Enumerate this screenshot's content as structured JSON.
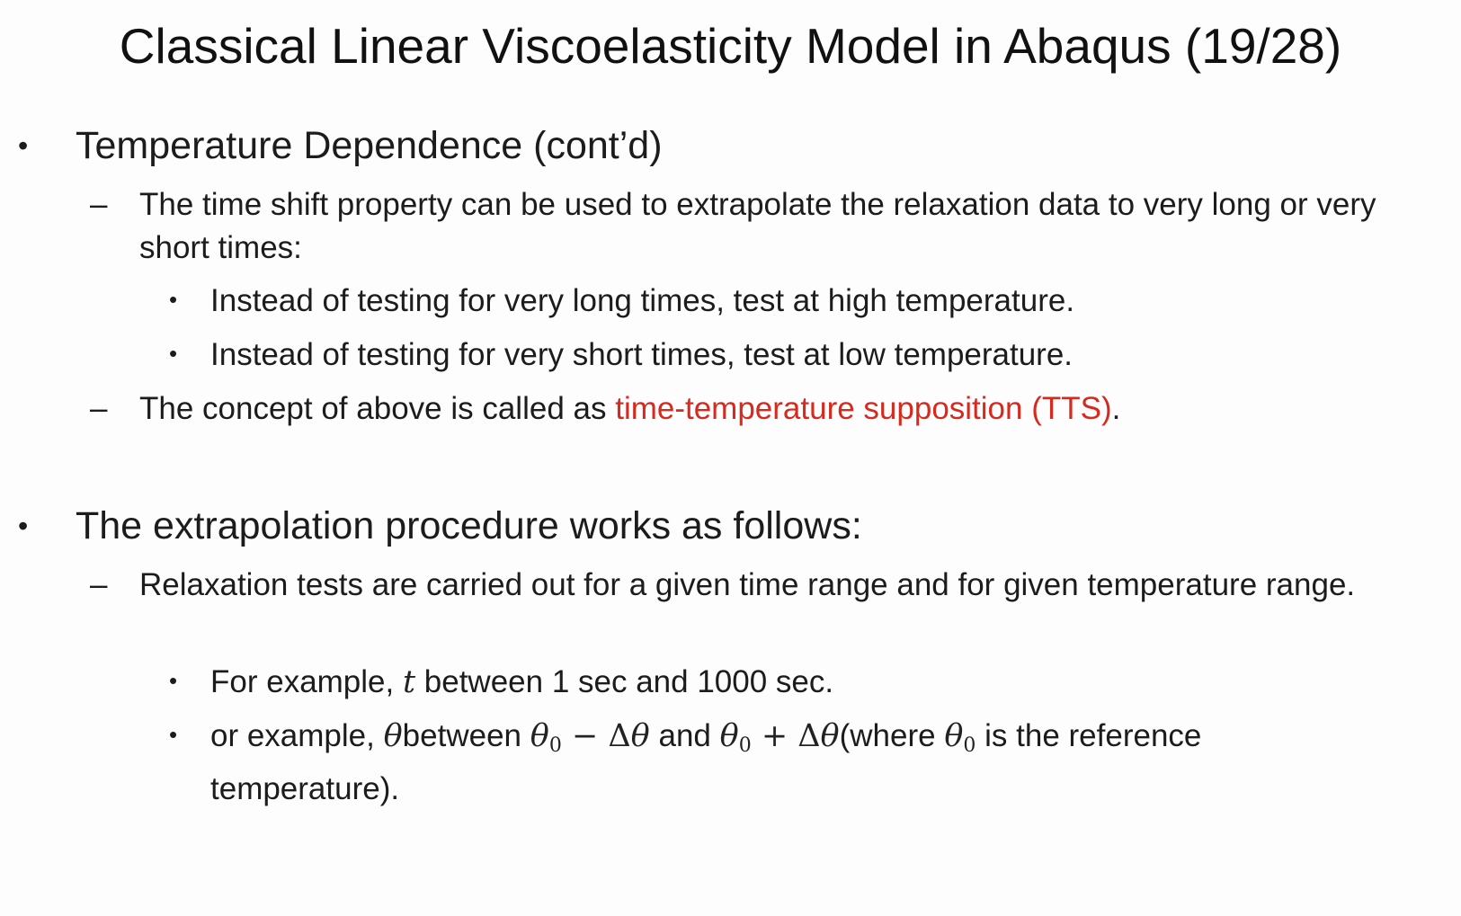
{
  "slide": {
    "title": "Classical Linear Viscoelasticity Model in Abaqus (19/28)",
    "sections": [
      {
        "bullet": "•",
        "heading": "Temperature Dependence (cont’d)",
        "dash1": {
          "marker": "–",
          "text": "The time shift property can be used to extrapolate the relaxation data to very long or very short times:"
        },
        "sub_items": [
          {
            "marker": "•",
            "text": "Instead of testing for very long times, test at high temperature."
          },
          {
            "marker": "•",
            "text": "Instead of testing for very short times, test at low temperature."
          }
        ],
        "dash2": {
          "marker": "–",
          "prefix": "The concept of above is called as ",
          "highlight": "time-temperature supposition (TTS)",
          "suffix": ".",
          "highlight_color": "#d52b1e"
        }
      },
      {
        "bullet": "•",
        "heading": "The extrapolation procedure works as follows:",
        "dash1": {
          "marker": "–",
          "text": "Relaxation tests are carried out for a given time range and for given temperature range."
        },
        "example1": {
          "marker": "•",
          "prefix": "For example, ",
          "var": "t",
          "suffix": " between 1 sec and 1000 sec."
        },
        "example2": {
          "marker": "•",
          "prefix": "or example, ",
          "theta": "θ",
          "between": "between ",
          "theta0a": "θ",
          "sub0a": "0",
          "minus": " − Δ",
          "theta_a": "θ",
          "and": " and ",
          "theta0b": "θ",
          "sub0b": "0",
          "plus": " + Δ",
          "theta_b": "θ",
          "where": "(where ",
          "theta0c": "θ",
          "sub0c": "0",
          "tail": " is the reference temperature)."
        }
      }
    ]
  }
}
